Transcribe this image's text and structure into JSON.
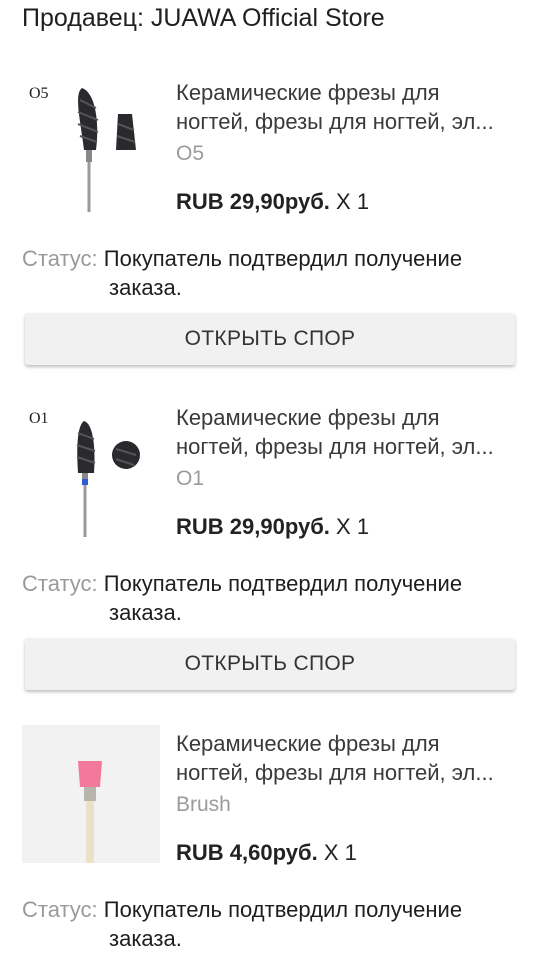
{
  "seller": {
    "label": "Продавец: JUAWA Official Store"
  },
  "items": [
    {
      "image_label": "O5",
      "title_line1": "Керамические фрезы для",
      "title_line2": "ногтей, фрезы для ногтей, эл...",
      "variant": "O5",
      "price": "RUB 29,90руб.",
      "quantity": "X 1",
      "status_label": "Статус:",
      "status_line1": "Покупатель подтвердил получение",
      "status_line2": "заказа.",
      "button": "ОТКРЫТЬ СПОР"
    },
    {
      "image_label": "O1",
      "title_line1": "Керамические фрезы для",
      "title_line2": "ногтей, фрезы для ногтей, эл...",
      "variant": "O1",
      "price": "RUB 29,90руб.",
      "quantity": "X 1",
      "status_label": "Статус:",
      "status_line1": "Покупатель подтвердил получение",
      "status_line2": "заказа.",
      "button": "ОТКРЫТЬ СПОР"
    },
    {
      "title_line1": "Керамические фрезы для",
      "title_line2": "ногтей, фрезы для ногтей, эл...",
      "variant": "Brush",
      "price": "RUB 4,60руб.",
      "quantity": "X 1",
      "status_label": "Статус:",
      "status_line1": "Покупатель подтвердил получение",
      "status_line2": "заказа."
    }
  ],
  "colors": {
    "brush_head": "#f2789c",
    "o1_ring": "#2b5fd0"
  }
}
